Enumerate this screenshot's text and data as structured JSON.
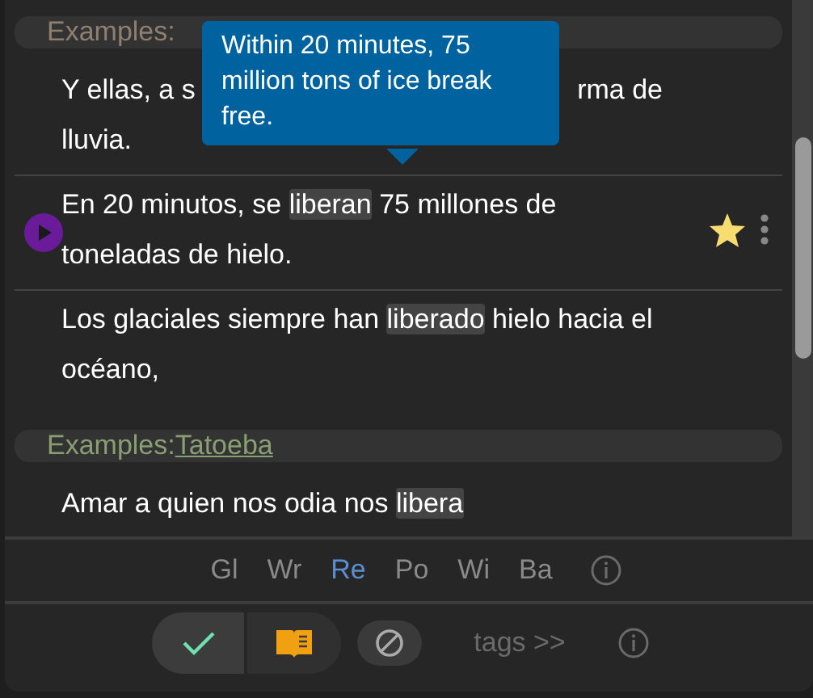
{
  "tooltip": {
    "text": "Within 20 minutes, 75 million tons of ice break free."
  },
  "sections": [
    {
      "label": "Examples:",
      "sentences": [
        {
          "kind": "covered",
          "lines": [
            [
              "Y ellas, a s",
              "rma de"
            ],
            [
              "lluvia."
            ]
          ],
          "playing": false,
          "starred": false
        },
        {
          "kind": "plain",
          "before": "En 20 minutos, se ",
          "highlight": "liberan",
          "after": " 75 millones de toneladas de hielo.",
          "playing": true,
          "starred": true
        },
        {
          "kind": "plain",
          "before": "Los glaciales siempre han ",
          "highlight": "liberado",
          "after": " hielo hacia el océano,",
          "playing": false,
          "starred": false
        }
      ]
    },
    {
      "label": "Examples: ",
      "link": "Tatoeba",
      "sentences": [
        {
          "kind": "plain",
          "before": "Amar a quien nos odia nos ",
          "highlight": "libera",
          "playing": false,
          "starred": false
        }
      ]
    }
  ],
  "tabs": [
    {
      "label": "Gl",
      "selected": false
    },
    {
      "label": "Wr",
      "selected": false
    },
    {
      "label": "Re",
      "selected": true
    },
    {
      "label": "Po",
      "selected": false
    },
    {
      "label": "Wi",
      "selected": false
    },
    {
      "label": "Ba",
      "selected": false
    }
  ],
  "actions": {
    "known": true,
    "tags_link": "tags >>"
  }
}
